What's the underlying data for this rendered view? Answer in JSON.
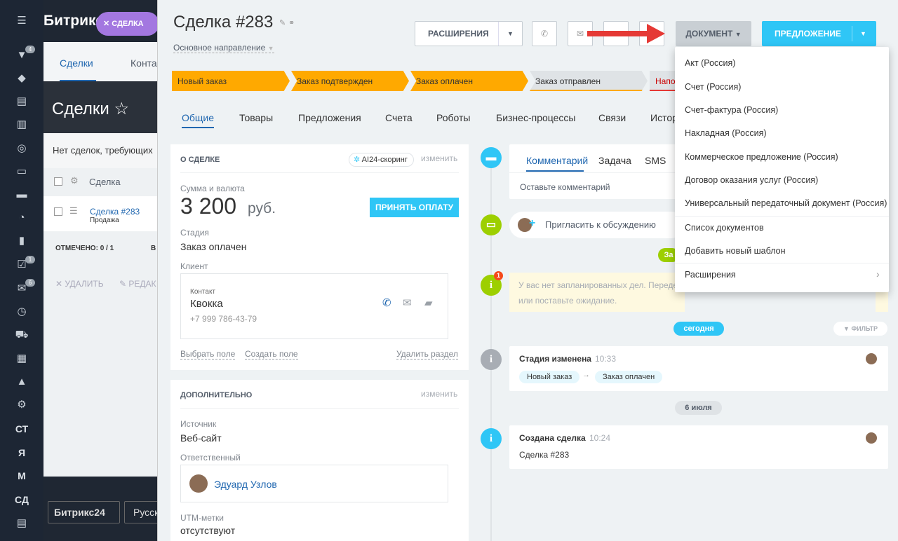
{
  "leftbar": {
    "badges": [
      "4",
      "1",
      "6"
    ],
    "texts": [
      "СТ",
      "Я",
      "М",
      "СД"
    ]
  },
  "bg": {
    "logo": "Битрикс",
    "chip": "СДЕЛКА",
    "tab1": "Сделки",
    "tab2": "Конта",
    "page_title": "Сделки",
    "note": "Нет сделок, требующих",
    "col_deal": "Сделка",
    "row_deal": "Сделка #283",
    "row_sub": "Продажа",
    "marked": "ОТМЕЧЕНО: 0 / 1",
    "marked2": "В",
    "delete": "УДАЛИТЬ",
    "edit": "РЕДАК",
    "bottom1": "Битрикс24",
    "bottom2": "Русск"
  },
  "header": {
    "title": "Сделка",
    "number": "#283",
    "direction": "Основное направление",
    "btn_ext": "РАСШИРЕНИЯ",
    "btn_doc": "ДОКУМЕНТ",
    "btn_offer": "ПРЕДЛОЖЕНИЕ"
  },
  "stages": [
    "Новый заказ",
    "Заказ подтвержден",
    "Заказ оплачен",
    "Заказ отправлен",
    "Напо"
  ],
  "tabs": [
    "Общие",
    "Товары",
    "Предложения",
    "Счета",
    "Роботы",
    "Бизнес-процессы",
    "Связи",
    "Истор"
  ],
  "about": {
    "title": "О СДЕЛКЕ",
    "scoring": "AI24-скоринг",
    "change": "изменить",
    "sum_label": "Сумма и валюта",
    "sum": "3 200",
    "currency": "руб.",
    "pay_btn": "ПРИНЯТЬ ОПЛАТУ",
    "stage_label": "Стадия",
    "stage_val": "Заказ оплачен",
    "client_label": "Клиент",
    "contact_label": "Контакт",
    "contact_name": "Квокка",
    "contact_phone": "+7 999 786-43-79",
    "pick_field": "Выбрать поле",
    "create_field": "Создать поле",
    "delete_section": "Удалить раздел"
  },
  "extra": {
    "title": "ДОПОЛНИТЕЛЬНО",
    "change": "изменить",
    "source_label": "Источник",
    "source_val": "Веб-сайт",
    "resp_label": "Ответственный",
    "resp_name": "Эдуард Узлов",
    "utm_label": "UTM-метки",
    "utm_val": "отсутствуют"
  },
  "timeline": {
    "tab_comment": "Комментарий",
    "tab_task": "Задача",
    "tab_sms": "SMS",
    "comment_placeholder": "Оставьте комментарий",
    "invite": "Пригласить к обсуждению",
    "za": "За",
    "warning_line1": "У вас нет запланированных дел. Переде",
    "warning_line2": "или поставьте ожидание.",
    "warn_badge": "1",
    "today": "сегодня",
    "filter": "ФИЛЬТР",
    "stage_changed": "Стадия изменена",
    "time1": "10:33",
    "from_stage": "Новый заказ",
    "to_stage": "Заказ оплачен",
    "date": "6 июля",
    "created": "Создана сделка",
    "time2": "10:24",
    "created_sub": "Сделка #283"
  },
  "menu": {
    "items": [
      "Акт (Россия)",
      "Счет (Россия)",
      "Счет-фактура (Россия)",
      "Накладная (Россия)",
      "Коммерческое предложение (Россия)",
      "Договор оказания услуг (Россия)",
      "Универсальный передаточный документ (Россия)",
      "Список документов",
      "Добавить новый шаблон",
      "Расширения"
    ]
  },
  "colors": {
    "accent": "#2fc6f6",
    "stage_orange": "#ffa900",
    "arrow": "#e53935"
  }
}
